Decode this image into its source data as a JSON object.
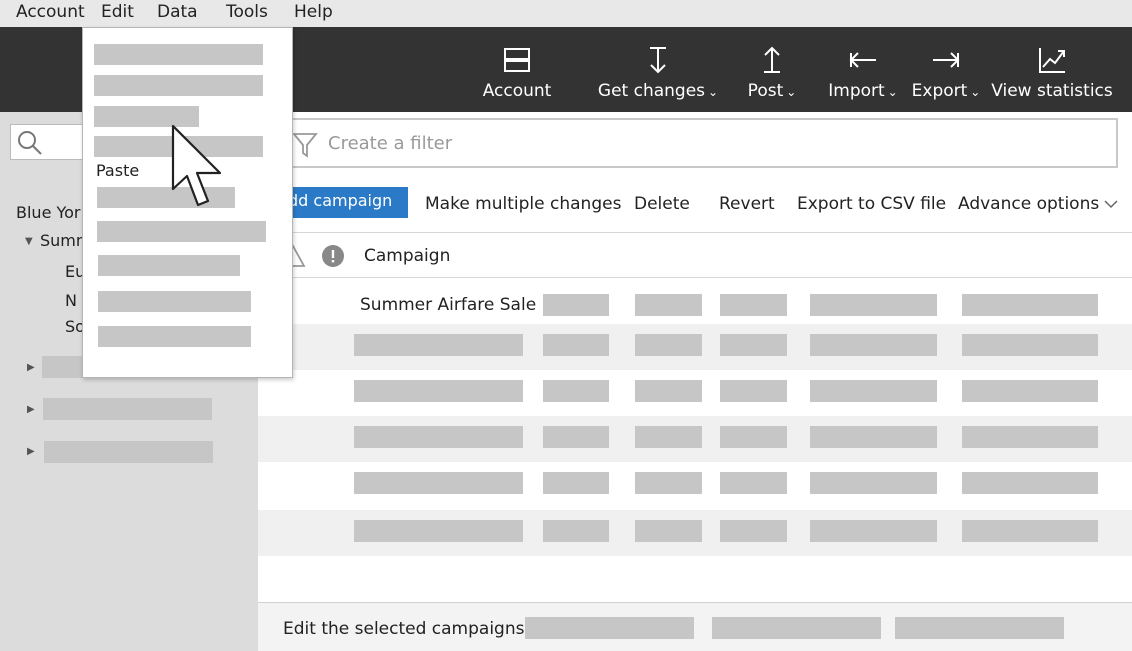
{
  "menubar": {
    "items": [
      "Account",
      "Edit",
      "Data",
      "Tools",
      "Help"
    ]
  },
  "toolbar": {
    "account": {
      "label": "Account",
      "icon": "layout-icon"
    },
    "get_changes": {
      "label": "Get changes",
      "icon": "download-arrow-icon"
    },
    "post": {
      "label": "Post",
      "icon": "upload-arrow-icon"
    },
    "import": {
      "label": "Import",
      "icon": "arrow-left-icon"
    },
    "export": {
      "label": "Export",
      "icon": "arrow-right-icon"
    },
    "view_statistics": {
      "label": "View statistics",
      "icon": "chart-line-icon"
    },
    "chevron": "⌄"
  },
  "edit_menu": {
    "paste_label": "Paste"
  },
  "sidebar": {
    "account_name": "Blue Yor",
    "campaign_name": "Summ",
    "child_1": "Eu",
    "child_2": "N",
    "child_3": "So"
  },
  "filter": {
    "placeholder": "Create a filter"
  },
  "actions": {
    "add_campaign": "dd campaign",
    "make_multiple_changes": "Make multiple changes",
    "delete": "Delete",
    "revert": "Revert",
    "export_csv": "Export to CSV file",
    "advance_options": "Advance options"
  },
  "table": {
    "column_campaign": "Campaign",
    "first_row_campaign": "Summer Airfare Sale"
  },
  "footer": {
    "label": "Edit the selected campaigns"
  },
  "colors": {
    "toolbar_bg": "#333333",
    "accent": "#2b7ac7",
    "sidebar_bg": "#dcdcdc"
  }
}
